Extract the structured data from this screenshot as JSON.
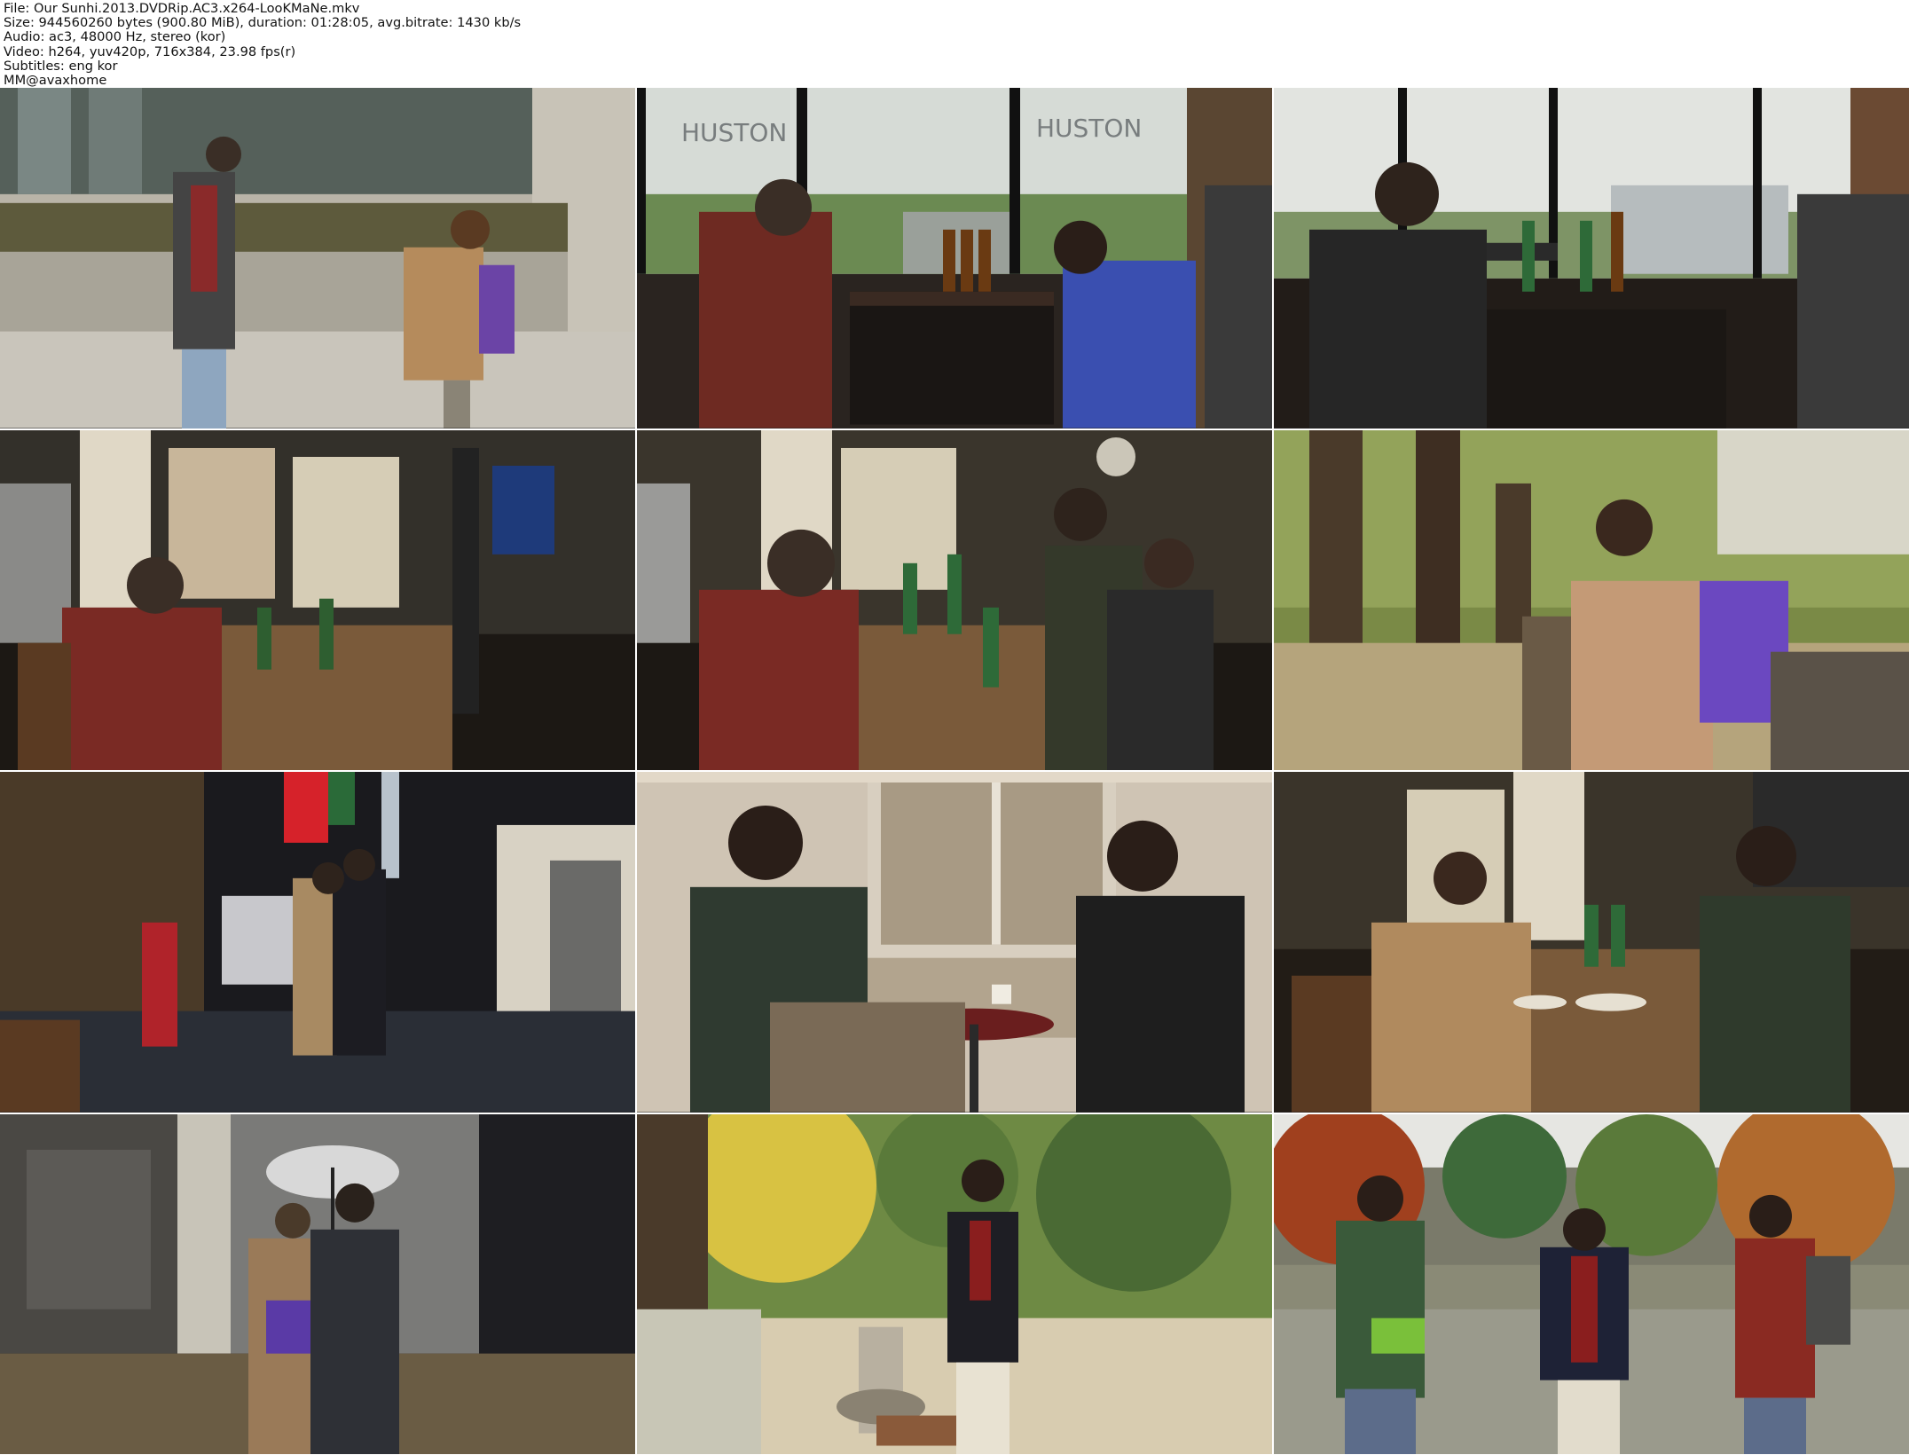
{
  "info": {
    "file": "File: Our Sunhi.2013.DVDRip.AC3.x264-LooKMaNe.mkv",
    "size": "Size: 944560260 bytes (900.80 MiB), duration: 01:28:05, avg.bitrate: 1430 kb/s",
    "audio": "Audio: ac3, 48000 Hz, stereo (kor)",
    "video": "Video: h264, yuv420p, 716x384, 23.98 fps(r)",
    "subtitles": "Subtitles: eng kor",
    "credit": "MM@avaxhome"
  },
  "thumbnails": [
    {
      "scene": "street-two-people-smoking"
    },
    {
      "scene": "cafe-window-couple-drinking"
    },
    {
      "scene": "cafe-man-alone-table"
    },
    {
      "scene": "bar-man-drinking-alone"
    },
    {
      "scene": "bar-three-people-talking"
    },
    {
      "scene": "park-woman-phone-bench"
    },
    {
      "scene": "night-alley-couple-hug"
    },
    {
      "scene": "cafe-two-men-talking"
    },
    {
      "scene": "bar-woman-man-table"
    },
    {
      "scene": "night-couple-umbrella"
    },
    {
      "scene": "park-man-on-phone"
    },
    {
      "scene": "pond-three-men-standing"
    }
  ],
  "sign_texts": {
    "cafe_window_1": "HUSTON",
    "cafe_window_2": "HUSTON"
  }
}
